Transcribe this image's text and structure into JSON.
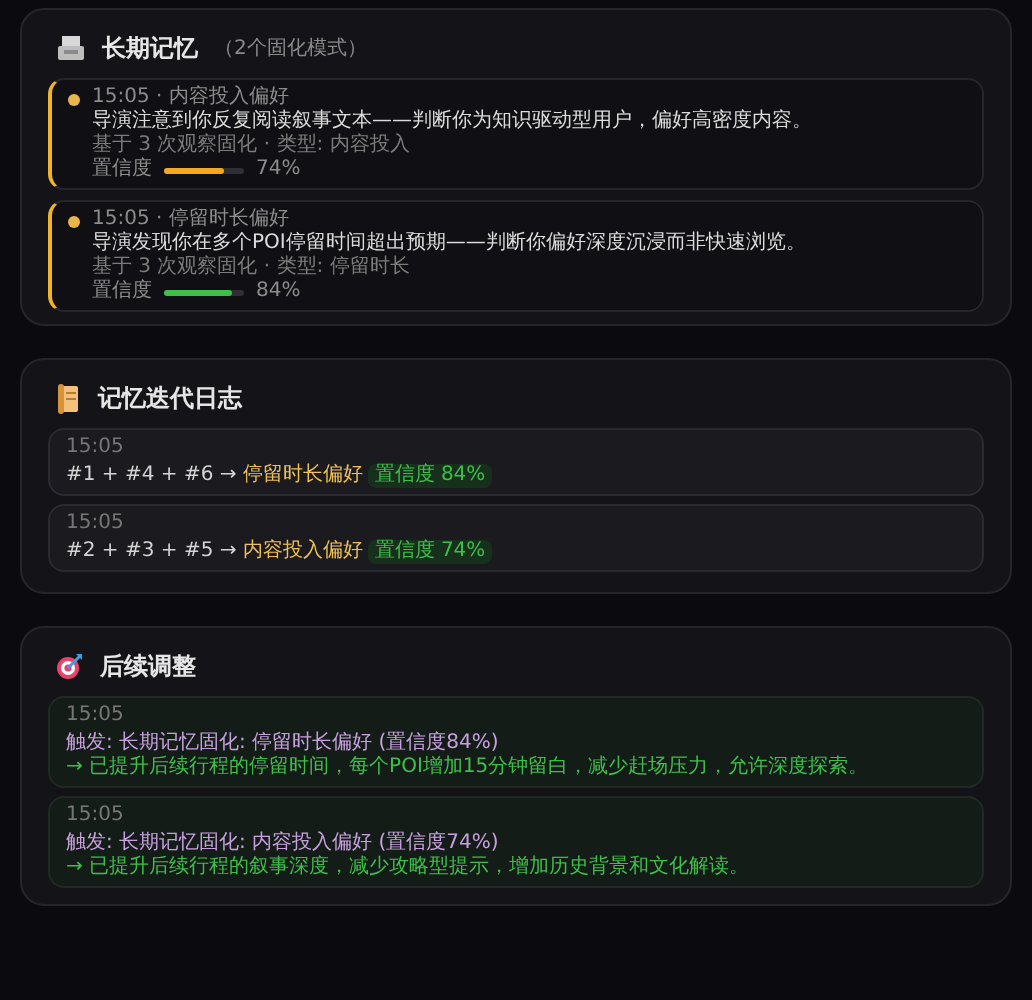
{
  "long_term_memory": {
    "title": "长期记忆",
    "subtitle": "（2个固化模式）",
    "items": [
      {
        "meta": "15:05 · 内容投入偏好",
        "text": "导演注意到你反复阅读叙事文本——判断你为知识驱动型用户，偏好高密度内容。",
        "basis": "基于 3 次观察固化 · 类型: 内容投入",
        "confidence_label": "置信度",
        "level": 0.74,
        "color": "#f5a623",
        "reading": "74%"
      },
      {
        "meta": "15:05 · 停留时长偏好",
        "text": "导演发现你在多个POI停留时间超出预期——判断你偏好深度沉浸而非快速浏览。",
        "basis": "基于 3 次观察固化 · 类型: 停留时长",
        "confidence_label": "置信度",
        "level": 0.84,
        "color": "#3fbf4a",
        "reading": "84%"
      }
    ]
  },
  "iteration_log": {
    "title": "记忆迭代日志",
    "entries": [
      {
        "time": "15:05",
        "sources": "#1 + #4 + #6 →",
        "result": "停留时长偏好",
        "badge": "置信度 84%"
      },
      {
        "time": "15:05",
        "sources": "#2 + #3 + #5 →",
        "result": "内容投入偏好",
        "badge": "置信度 74%"
      }
    ]
  },
  "adjustments": {
    "title": "后续调整",
    "entries": [
      {
        "time": "15:05",
        "trigger": "触发: 长期记忆固化: 停留时长偏好 (置信度84%)",
        "action": "→ 已提升后续行程的停留时间，每个POI增加15分钟留白，减少赶场压力，允许深度探索。"
      },
      {
        "time": "15:05",
        "trigger": "触发: 长期记忆固化: 内容投入偏好 (置信度74%)",
        "action": "→ 已提升后续行程的叙事深度，减少攻略型提示，增加历史背景和文化解读。"
      }
    ]
  }
}
